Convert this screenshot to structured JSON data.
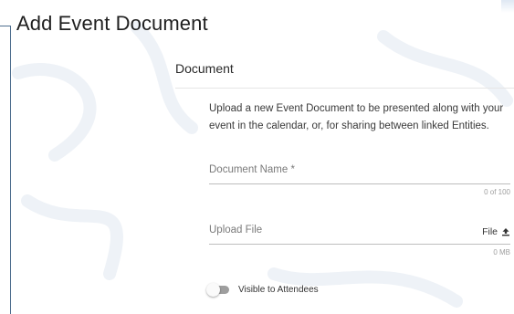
{
  "dialog": {
    "title": "Add Event Document"
  },
  "section": {
    "label": "Document",
    "description": "Upload a new Event Document to be presented along with your event in the calendar, or, for sharing between linked Entities."
  },
  "fields": {
    "document_name": {
      "label": "Document Name *",
      "counter": "0 of 100"
    },
    "upload_file": {
      "label": "Upload File",
      "action_label": "File",
      "action_icon": "upload-icon",
      "size": "0 MB"
    }
  },
  "toggle": {
    "label": "Visible to Attendees",
    "checked": false
  },
  "colors": {
    "frame_line": "#4f6f8f",
    "toggle_track": "#9e9e9e",
    "underline": "#bdbdbd"
  }
}
